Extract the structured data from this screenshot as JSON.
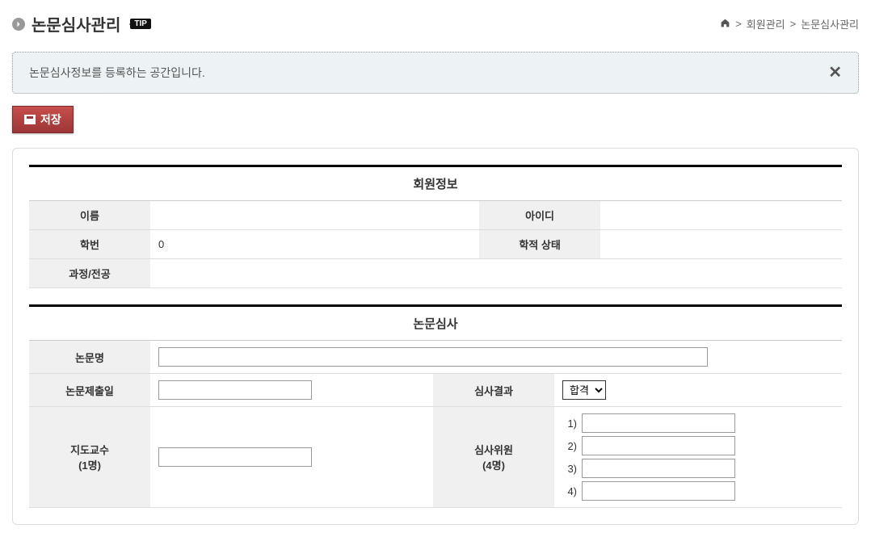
{
  "header": {
    "title": "논문심사관리",
    "tip_label": "TIP"
  },
  "breadcrumb": {
    "sep": ">",
    "items": [
      "회원관리",
      "논문심사관리"
    ]
  },
  "info": {
    "message": "논문심사정보를 등록하는 공간입니다."
  },
  "actions": {
    "save_label": "저장"
  },
  "member_info": {
    "section_title": "회원정보",
    "labels": {
      "name": "이름",
      "user_id": "아이디",
      "student_no": "학번",
      "status": "학적 상태",
      "course_major": "과정/전공"
    },
    "values": {
      "name": "",
      "user_id": "",
      "student_no": "0",
      "status": "",
      "course_major": ""
    }
  },
  "review": {
    "section_title": "논문심사",
    "labels": {
      "thesis_title": "논문명",
      "submit_date": "논문제출일",
      "result": "심사결과",
      "advisor": "지도교수",
      "advisor_sub": "(1명)",
      "reviewers": "심사위원",
      "reviewers_sub": "(4명)"
    },
    "values": {
      "thesis_title": "",
      "submit_date": "",
      "advisor": "",
      "reviewer1": "",
      "reviewer2": "",
      "reviewer3": "",
      "reviewer4": ""
    },
    "result_options": [
      "합격"
    ],
    "result_selected": "합격",
    "reviewer_nums": {
      "n1": "1)",
      "n2": "2)",
      "n3": "3)",
      "n4": "4)"
    }
  }
}
